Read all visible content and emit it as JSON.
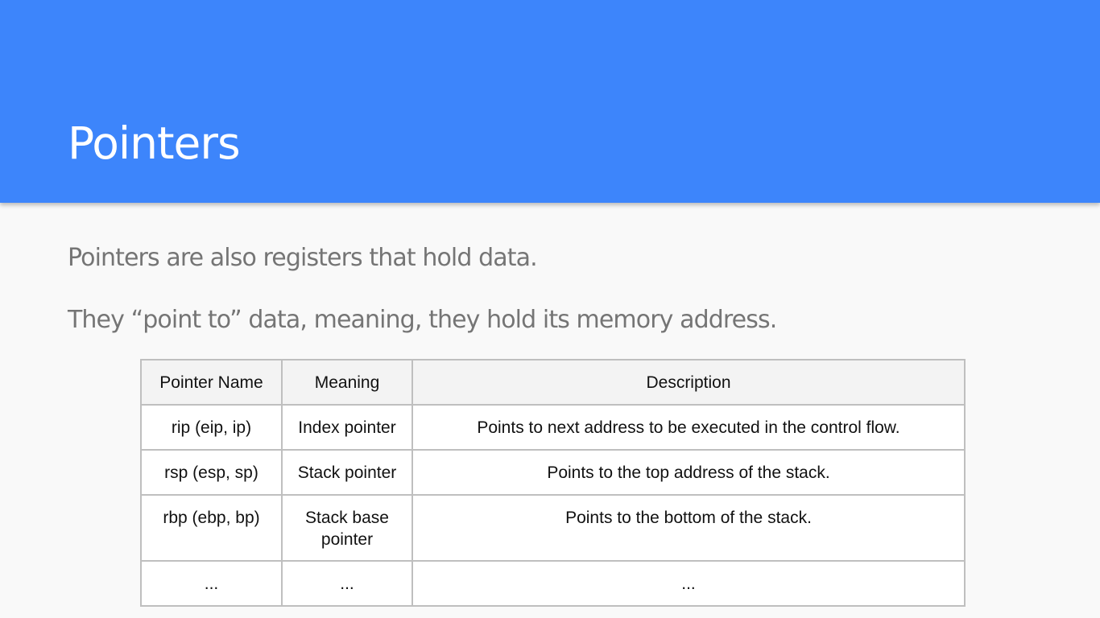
{
  "slide": {
    "title": "Pointers",
    "body_lines": [
      "Pointers are also registers that hold data.",
      "They “point to” data, meaning, they hold its memory address."
    ]
  },
  "table": {
    "headers": [
      "Pointer Name",
      "Meaning",
      "Description"
    ],
    "rows": [
      [
        "rip (eip, ip)",
        "Index pointer",
        "Points to next address to be executed in the control flow."
      ],
      [
        "rsp (esp, sp)",
        "Stack pointer",
        "Points to the top address of the stack."
      ],
      [
        "rbp (ebp, bp)",
        "Stack base pointer",
        "Points to the bottom of the stack."
      ],
      [
        "...",
        "...",
        "..."
      ]
    ]
  },
  "colors": {
    "header_background": "#3d85fb",
    "title_text": "#ffffff",
    "body_text": "#757575",
    "table_border": "#bfbfbf",
    "table_header_background": "#f3f3f3"
  }
}
